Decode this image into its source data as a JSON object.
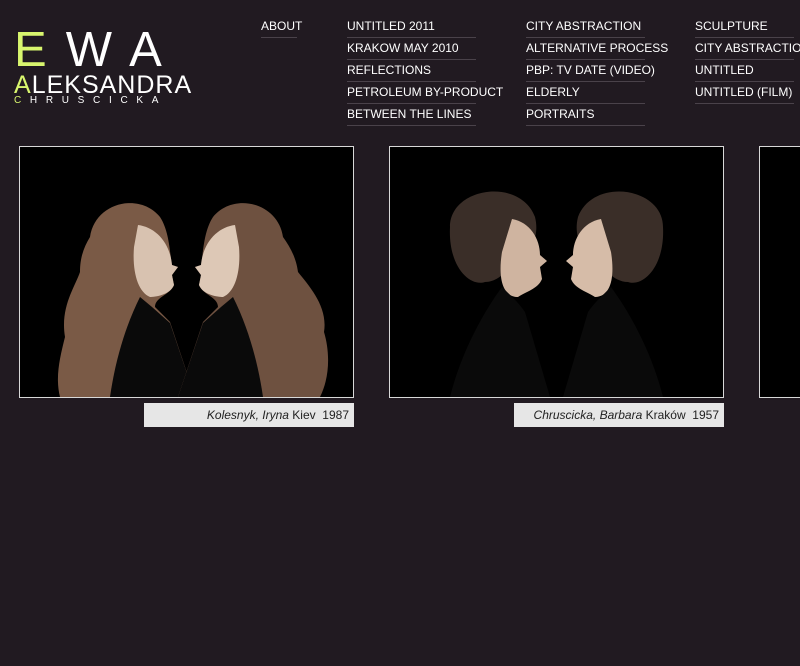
{
  "logo": {
    "line1_first": "E",
    "line1_rest": "WA",
    "line2_first": "A",
    "line2_rest": "LEKSANDRA",
    "line3_first": "C",
    "line3_rest": "HRUSCICKA"
  },
  "nav": {
    "about": "ABOUT",
    "col1": [
      "UNTITLED 2011",
      "KRAKOW MAY 2010",
      "REFLECTIONS",
      "PETROLEUM BY-PRODUCT",
      "BETWEEN THE LINES"
    ],
    "col2": [
      "CITY ABSTRACTION",
      "ALTERNATIVE PROCESS",
      "PBP: TV DATE (VIDEO)",
      "ELDERLY",
      "PORTRAITS"
    ],
    "col3": [
      "SCULPTURE",
      "CITY ABSTRACTION",
      "UNTITLED",
      "UNTITLED (FILM)"
    ]
  },
  "gallery": [
    {
      "name": "Kolesnyk, Iryna",
      "place": "Kiev",
      "year": "1987"
    },
    {
      "name": "Chruscicka, Barbara",
      "place": "Kraków",
      "year": "1957"
    }
  ],
  "colors": {
    "background": "#211a21",
    "accent": "#d8f56e",
    "caption_bg": "#e6e6e6"
  }
}
